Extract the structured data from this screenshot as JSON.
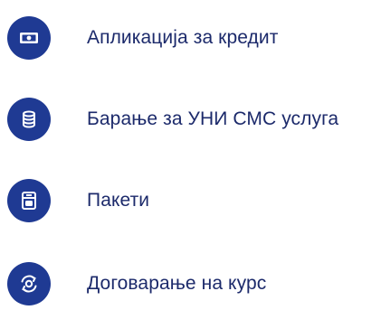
{
  "menu": {
    "accent_color": "#1f3a93",
    "label_color": "#1c2a6b",
    "items": [
      {
        "label": "Апликација за кредит",
        "icon": "banknote-icon"
      },
      {
        "label": "Барање за УНИ СМС услуга",
        "icon": "coin-stack-icon"
      },
      {
        "label": "Пакети",
        "icon": "package-icon"
      },
      {
        "label": "Договарање на курс",
        "icon": "currency-exchange-icon"
      }
    ]
  }
}
